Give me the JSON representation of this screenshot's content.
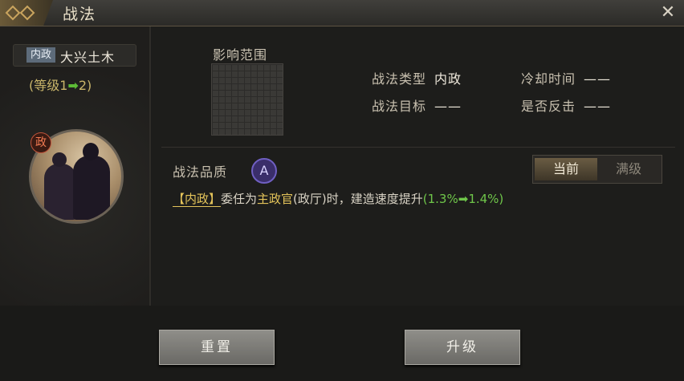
{
  "window": {
    "title": "战法"
  },
  "skill": {
    "type_tag": "内政",
    "name": "大兴土木",
    "level_prefix": "(等级1",
    "level_arrow": "➡",
    "level_suffix": "2)",
    "portrait_badge": "政"
  },
  "details": {
    "range_label": "影响范围",
    "type_label": "战法类型",
    "type_value": "内政",
    "cooldown_label": "冷却时间",
    "cooldown_value": "——",
    "target_label": "战法目标",
    "target_value": "——",
    "counter_label": "是否反击",
    "counter_value": "——"
  },
  "quality": {
    "label": "战法品质",
    "grade": "A",
    "toggle_current": "当前",
    "toggle_max": "满级"
  },
  "description": {
    "tag": "【内政】",
    "part1": "委任为",
    "highlight1": "主政官",
    "part2": "(政厅)时，建造速度提升",
    "open_paren": "(",
    "value_from": "1.3%",
    "arrow": "➡",
    "value_to": "1.4%",
    "close_paren": ")"
  },
  "buttons": {
    "reset": "重置",
    "upgrade": "升级"
  },
  "colors": {
    "accent_gold": "#e3c35a",
    "accent_green": "#6fc64a",
    "quality_purple": "#6f5fc2"
  },
  "icons": {
    "close": "close-icon",
    "title": "ornament-icon"
  }
}
